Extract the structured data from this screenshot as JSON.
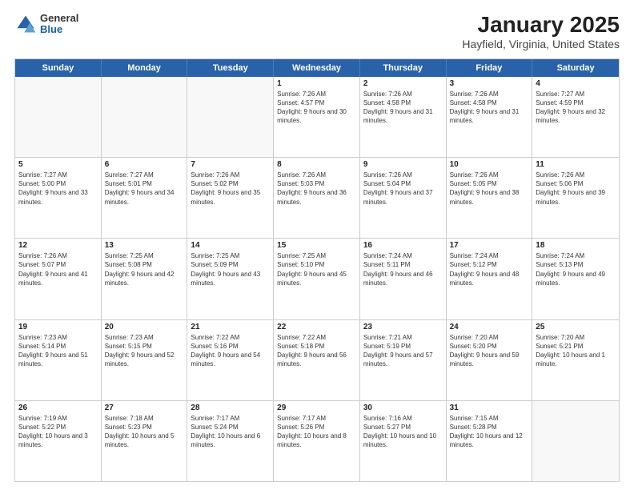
{
  "header": {
    "logo": {
      "general": "General",
      "blue": "Blue"
    },
    "title": "January 2025",
    "subtitle": "Hayfield, Virginia, United States"
  },
  "weekdays": [
    "Sunday",
    "Monday",
    "Tuesday",
    "Wednesday",
    "Thursday",
    "Friday",
    "Saturday"
  ],
  "weeks": [
    [
      {
        "day": "",
        "sunrise": "",
        "sunset": "",
        "daylight": "",
        "empty": true
      },
      {
        "day": "",
        "sunrise": "",
        "sunset": "",
        "daylight": "",
        "empty": true
      },
      {
        "day": "",
        "sunrise": "",
        "sunset": "",
        "daylight": "",
        "empty": true
      },
      {
        "day": "1",
        "sunrise": "Sunrise: 7:26 AM",
        "sunset": "Sunset: 4:57 PM",
        "daylight": "Daylight: 9 hours and 30 minutes."
      },
      {
        "day": "2",
        "sunrise": "Sunrise: 7:26 AM",
        "sunset": "Sunset: 4:58 PM",
        "daylight": "Daylight: 9 hours and 31 minutes."
      },
      {
        "day": "3",
        "sunrise": "Sunrise: 7:26 AM",
        "sunset": "Sunset: 4:58 PM",
        "daylight": "Daylight: 9 hours and 31 minutes."
      },
      {
        "day": "4",
        "sunrise": "Sunrise: 7:27 AM",
        "sunset": "Sunset: 4:59 PM",
        "daylight": "Daylight: 9 hours and 32 minutes."
      }
    ],
    [
      {
        "day": "5",
        "sunrise": "Sunrise: 7:27 AM",
        "sunset": "Sunset: 5:00 PM",
        "daylight": "Daylight: 9 hours and 33 minutes."
      },
      {
        "day": "6",
        "sunrise": "Sunrise: 7:27 AM",
        "sunset": "Sunset: 5:01 PM",
        "daylight": "Daylight: 9 hours and 34 minutes."
      },
      {
        "day": "7",
        "sunrise": "Sunrise: 7:26 AM",
        "sunset": "Sunset: 5:02 PM",
        "daylight": "Daylight: 9 hours and 35 minutes."
      },
      {
        "day": "8",
        "sunrise": "Sunrise: 7:26 AM",
        "sunset": "Sunset: 5:03 PM",
        "daylight": "Daylight: 9 hours and 36 minutes."
      },
      {
        "day": "9",
        "sunrise": "Sunrise: 7:26 AM",
        "sunset": "Sunset: 5:04 PM",
        "daylight": "Daylight: 9 hours and 37 minutes."
      },
      {
        "day": "10",
        "sunrise": "Sunrise: 7:26 AM",
        "sunset": "Sunset: 5:05 PM",
        "daylight": "Daylight: 9 hours and 38 minutes."
      },
      {
        "day": "11",
        "sunrise": "Sunrise: 7:26 AM",
        "sunset": "Sunset: 5:06 PM",
        "daylight": "Daylight: 9 hours and 39 minutes."
      }
    ],
    [
      {
        "day": "12",
        "sunrise": "Sunrise: 7:26 AM",
        "sunset": "Sunset: 5:07 PM",
        "daylight": "Daylight: 9 hours and 41 minutes."
      },
      {
        "day": "13",
        "sunrise": "Sunrise: 7:25 AM",
        "sunset": "Sunset: 5:08 PM",
        "daylight": "Daylight: 9 hours and 42 minutes."
      },
      {
        "day": "14",
        "sunrise": "Sunrise: 7:25 AM",
        "sunset": "Sunset: 5:09 PM",
        "daylight": "Daylight: 9 hours and 43 minutes."
      },
      {
        "day": "15",
        "sunrise": "Sunrise: 7:25 AM",
        "sunset": "Sunset: 5:10 PM",
        "daylight": "Daylight: 9 hours and 45 minutes."
      },
      {
        "day": "16",
        "sunrise": "Sunrise: 7:24 AM",
        "sunset": "Sunset: 5:11 PM",
        "daylight": "Daylight: 9 hours and 46 minutes."
      },
      {
        "day": "17",
        "sunrise": "Sunrise: 7:24 AM",
        "sunset": "Sunset: 5:12 PM",
        "daylight": "Daylight: 9 hours and 48 minutes."
      },
      {
        "day": "18",
        "sunrise": "Sunrise: 7:24 AM",
        "sunset": "Sunset: 5:13 PM",
        "daylight": "Daylight: 9 hours and 49 minutes."
      }
    ],
    [
      {
        "day": "19",
        "sunrise": "Sunrise: 7:23 AM",
        "sunset": "Sunset: 5:14 PM",
        "daylight": "Daylight: 9 hours and 51 minutes."
      },
      {
        "day": "20",
        "sunrise": "Sunrise: 7:23 AM",
        "sunset": "Sunset: 5:15 PM",
        "daylight": "Daylight: 9 hours and 52 minutes."
      },
      {
        "day": "21",
        "sunrise": "Sunrise: 7:22 AM",
        "sunset": "Sunset: 5:16 PM",
        "daylight": "Daylight: 9 hours and 54 minutes."
      },
      {
        "day": "22",
        "sunrise": "Sunrise: 7:22 AM",
        "sunset": "Sunset: 5:18 PM",
        "daylight": "Daylight: 9 hours and 56 minutes."
      },
      {
        "day": "23",
        "sunrise": "Sunrise: 7:21 AM",
        "sunset": "Sunset: 5:19 PM",
        "daylight": "Daylight: 9 hours and 57 minutes."
      },
      {
        "day": "24",
        "sunrise": "Sunrise: 7:20 AM",
        "sunset": "Sunset: 5:20 PM",
        "daylight": "Daylight: 9 hours and 59 minutes."
      },
      {
        "day": "25",
        "sunrise": "Sunrise: 7:20 AM",
        "sunset": "Sunset: 5:21 PM",
        "daylight": "Daylight: 10 hours and 1 minute."
      }
    ],
    [
      {
        "day": "26",
        "sunrise": "Sunrise: 7:19 AM",
        "sunset": "Sunset: 5:22 PM",
        "daylight": "Daylight: 10 hours and 3 minutes."
      },
      {
        "day": "27",
        "sunrise": "Sunrise: 7:18 AM",
        "sunset": "Sunset: 5:23 PM",
        "daylight": "Daylight: 10 hours and 5 minutes."
      },
      {
        "day": "28",
        "sunrise": "Sunrise: 7:17 AM",
        "sunset": "Sunset: 5:24 PM",
        "daylight": "Daylight: 10 hours and 6 minutes."
      },
      {
        "day": "29",
        "sunrise": "Sunrise: 7:17 AM",
        "sunset": "Sunset: 5:26 PM",
        "daylight": "Daylight: 10 hours and 8 minutes."
      },
      {
        "day": "30",
        "sunrise": "Sunrise: 7:16 AM",
        "sunset": "Sunset: 5:27 PM",
        "daylight": "Daylight: 10 hours and 10 minutes."
      },
      {
        "day": "31",
        "sunrise": "Sunrise: 7:15 AM",
        "sunset": "Sunset: 5:28 PM",
        "daylight": "Daylight: 10 hours and 12 minutes."
      },
      {
        "day": "",
        "sunrise": "",
        "sunset": "",
        "daylight": "",
        "empty": true
      }
    ]
  ]
}
